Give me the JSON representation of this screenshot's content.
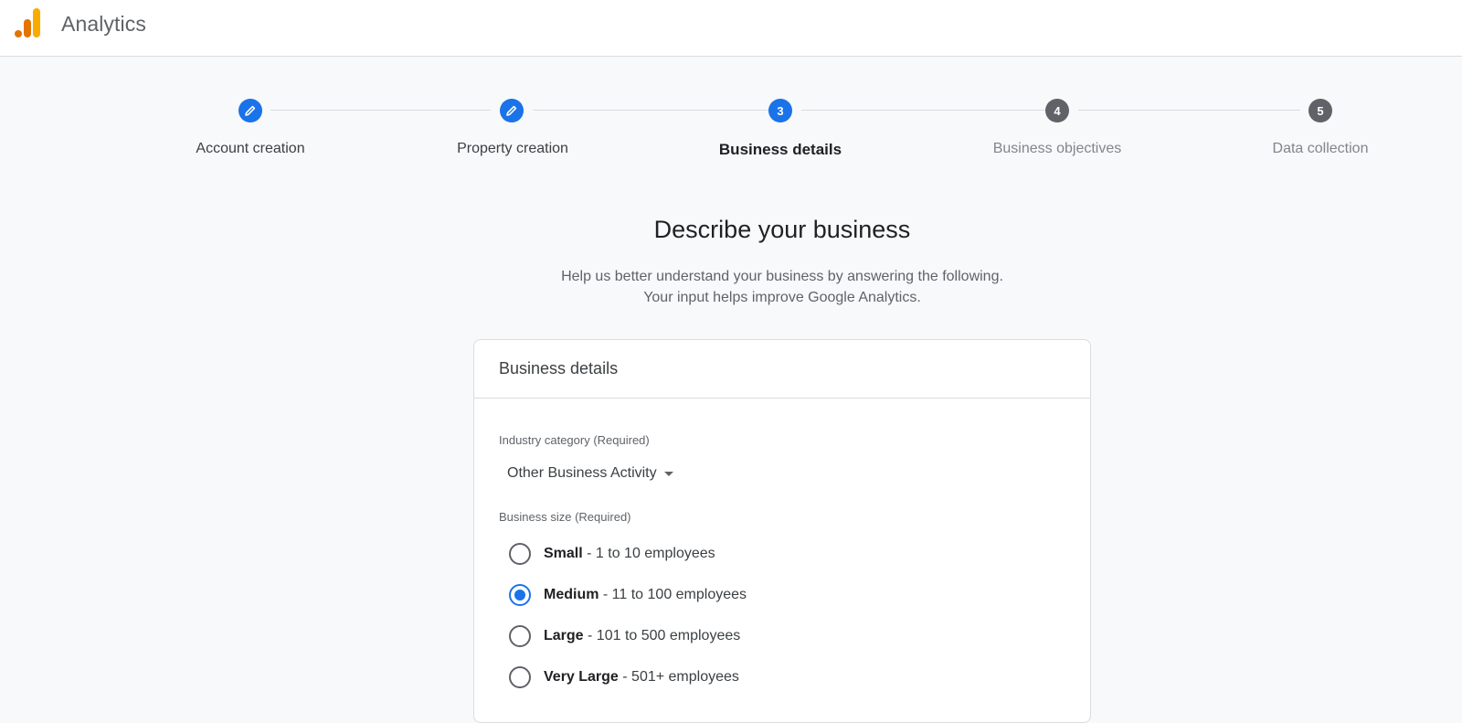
{
  "app": {
    "title": "Analytics",
    "logo_colors": [
      "#f9ab00",
      "#e37400"
    ]
  },
  "stepper": {
    "steps": [
      {
        "label": "Account creation",
        "status": "done",
        "icon": "pencil-icon"
      },
      {
        "label": "Property creation",
        "status": "done",
        "icon": "pencil-icon"
      },
      {
        "label": "Business details",
        "number": "3",
        "status": "active"
      },
      {
        "label": "Business objectives",
        "number": "4",
        "status": "pending"
      },
      {
        "label": "Data collection",
        "number": "5",
        "status": "pending"
      }
    ]
  },
  "page": {
    "title": "Describe your business",
    "subtitle_line1": "Help us better understand your business by answering the following.",
    "subtitle_line2": "Your input helps improve Google Analytics."
  },
  "card": {
    "title": "Business details",
    "industry": {
      "label": "Industry category (Required)",
      "value": "Other Business Activity"
    },
    "size": {
      "label": "Business size (Required)",
      "options": [
        {
          "name": "Small",
          "desc": " - 1 to 10 employees",
          "checked": false
        },
        {
          "name": "Medium",
          "desc": " - 11 to 100 employees",
          "checked": true
        },
        {
          "name": "Large",
          "desc": " - 101 to 500 employees",
          "checked": false
        },
        {
          "name": "Very Large",
          "desc": " - 501+ employees",
          "checked": false
        }
      ]
    }
  },
  "colors": {
    "accent": "#1a73e8",
    "pending_step": "#5f6368"
  }
}
